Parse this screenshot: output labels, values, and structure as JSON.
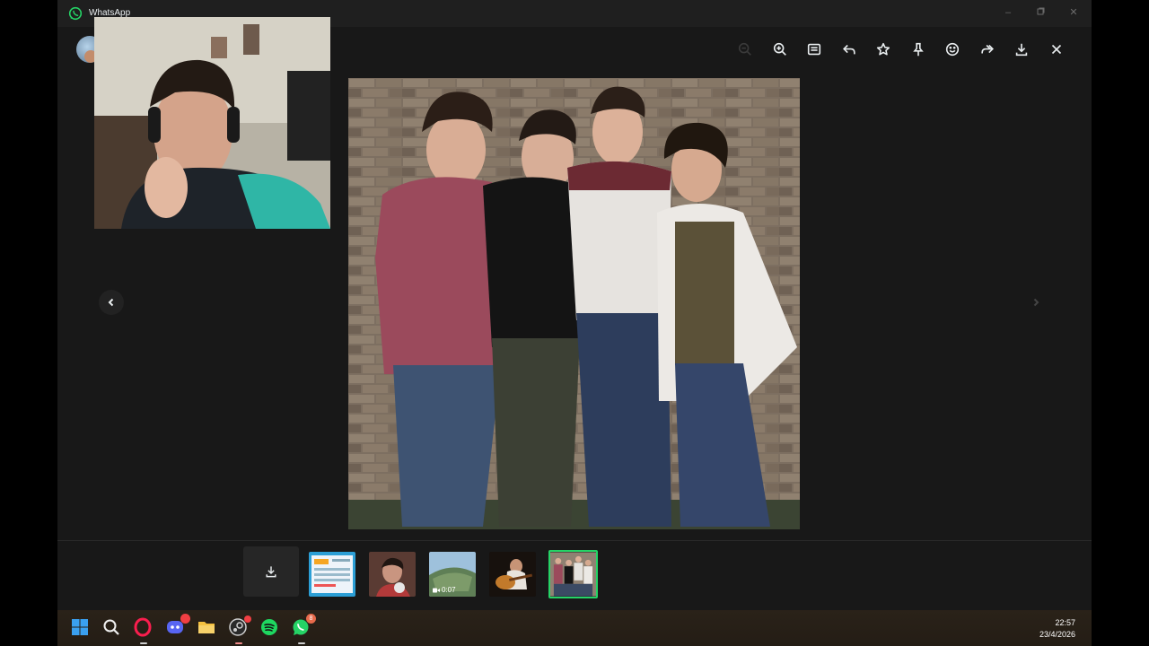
{
  "window": {
    "title": "WhatsApp",
    "controls": [
      "minimize",
      "maximize",
      "close"
    ]
  },
  "toolbar": {
    "buttons": [
      {
        "name": "zoom-out",
        "icon": "zoom-out-icon",
        "enabled": false
      },
      {
        "name": "zoom-in",
        "icon": "zoom-in-icon",
        "enabled": true
      },
      {
        "name": "view-in-chat",
        "icon": "chat-icon",
        "enabled": true
      },
      {
        "name": "reply",
        "icon": "reply-icon",
        "enabled": true
      },
      {
        "name": "star",
        "icon": "star-icon",
        "enabled": true
      },
      {
        "name": "pin",
        "icon": "pin-icon",
        "enabled": true
      },
      {
        "name": "react",
        "icon": "smiley-icon",
        "enabled": true
      },
      {
        "name": "forward",
        "icon": "forward-icon",
        "enabled": true
      },
      {
        "name": "download",
        "icon": "download-icon",
        "enabled": true
      },
      {
        "name": "close",
        "icon": "close-icon",
        "enabled": true
      }
    ]
  },
  "thumbnails": [
    {
      "name": "thumb-screenshot",
      "kind": "image"
    },
    {
      "name": "thumb-portrait",
      "kind": "image"
    },
    {
      "name": "thumb-video",
      "kind": "video",
      "duration": "0:07"
    },
    {
      "name": "thumb-guitar",
      "kind": "image"
    },
    {
      "name": "thumb-group-photo",
      "kind": "image",
      "selected": true
    }
  ],
  "taskbar": {
    "apps": [
      "start",
      "search",
      "opera-gx",
      "discord",
      "file-explorer",
      "steam",
      "spotify",
      "whatsapp"
    ],
    "whatsapp_badge": "8",
    "time": "22:57",
    "date": "23/4/2026"
  },
  "colors": {
    "accent": "#25d366",
    "background": "#181818",
    "titlebar": "#1f1f1f"
  }
}
